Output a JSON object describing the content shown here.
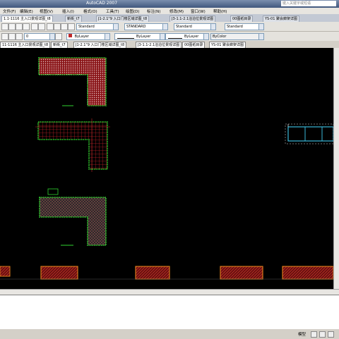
{
  "window": {
    "title": "AutoCAD 2007",
    "search_placeholder": "键入关键字或短语"
  },
  "menu": [
    "文件(F)",
    "编辑(E)",
    "视图(V)",
    "插入(I)",
    "格式(O)",
    "工具(T)",
    "绘图(D)",
    "标注(N)",
    "修改(M)",
    "窗口(W)",
    "帮助(H)"
  ],
  "document_tabs": [
    {
      "label": "1.1-1116 主入口景观详图_t8"
    },
    {
      "label": "新街_t7"
    },
    {
      "label": "J1-2.1\"9 入口门楼区域详图_t8"
    },
    {
      "label": "J3-1.1-2.1泊泊位景观详图"
    },
    {
      "label": "00图纸目录"
    },
    {
      "label": "YS-01 聚会廊架详图"
    }
  ],
  "toolbar": {
    "text_style": "Standard",
    "dim_style": "STANDARD",
    "table_style": "Standard",
    "mleader_style": "Standard",
    "layer": "0",
    "color": "ByLayer",
    "linetype": "ByLayer",
    "lineweight": "ByLayer",
    "plotstyle": "ByColor"
  },
  "file_tabs": [
    {
      "label": "11-1116 主入口景观详图_t8"
    },
    {
      "label": "新街_t7"
    },
    {
      "label": "J1-2.1\"9 入口门楼区域详图_t8"
    },
    {
      "label": "J3-1.1-2.1泊泊位景观详图"
    },
    {
      "label": "00图纸目录"
    },
    {
      "label": "YS-01 聚会廊架详图"
    }
  ],
  "status": {
    "model_label": "模型"
  },
  "colors": {
    "canvas": "#000000",
    "hatch_red": "#c0282a",
    "outline_green": "#2fd42f",
    "elevation_orange": "#d97a1a",
    "cyan_frame": "#3ab8d8"
  },
  "icons": [
    "new-icon",
    "open-icon",
    "save-icon",
    "print-icon",
    "undo-icon",
    "redo-icon",
    "layer-icon",
    "match-icon"
  ]
}
